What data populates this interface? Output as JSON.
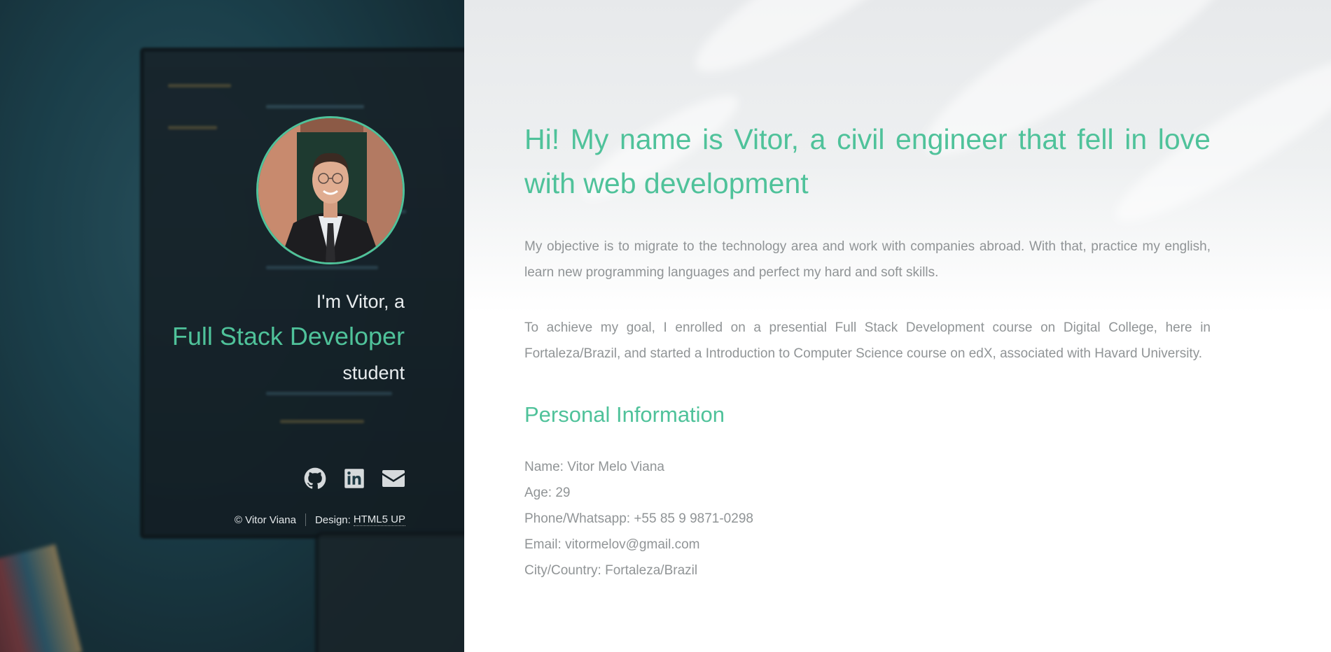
{
  "header": {
    "intro": "I'm Vitor, a",
    "role": "Full Stack Developer",
    "student": "student",
    "avatar_alt": "Profile photo of Vitor",
    "social": [
      {
        "name": "GitHub",
        "icon": "github-icon"
      },
      {
        "name": "LinkedIn",
        "icon": "linkedin-icon"
      },
      {
        "name": "Email",
        "icon": "envelope-icon"
      }
    ],
    "footer": {
      "copyright": "© Vitor Viana",
      "design_label": "Design:",
      "design_link": "HTML5 UP"
    }
  },
  "main": {
    "headline": "Hi! My name is Vitor, a civil engineer that fell in love with web development",
    "paragraphs": [
      "My objective is to migrate to the technology area and work with companies abroad. With that, practice my english, learn new programming languages and perfect my hard and soft skills.",
      "To achieve my goal, I enrolled on a presential Full Stack Development course on Digital College, here in Fortaleza/Brazil, and started a Introduction to Computer Science course on edX, associated with Havard University."
    ],
    "section_title": "Personal Information",
    "info": [
      "Name: Vitor Melo Viana",
      "Age: 29",
      "Phone/Whatsapp: +55 85 9 9871-0298",
      "Email: vitormelov@gmail.com",
      "City/Country: Fortaleza/Brazil"
    ]
  },
  "colors": {
    "accent": "#4fc29a",
    "body_text": "#909496",
    "header_text": "#e8ecee"
  }
}
